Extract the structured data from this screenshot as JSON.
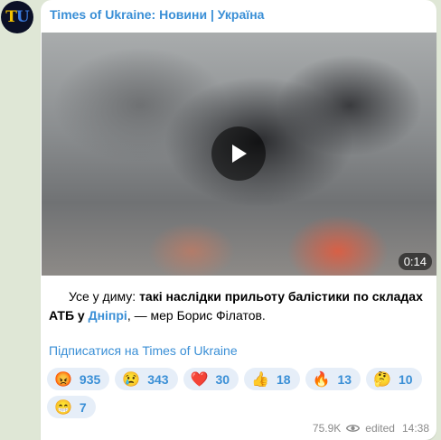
{
  "channel": {
    "avatar_letter_1": "T",
    "avatar_letter_2": "U",
    "name": "Times of Ukraine: Новини | Україна"
  },
  "video": {
    "duration": "0:14"
  },
  "post": {
    "text_part1": "Усе у диму: ",
    "text_bold": "такі наслідки прильоту балістики по складах АТБ у ",
    "text_link": "Дніпрі",
    "text_part2": ", — мер Борис Філатов.",
    "subscribe": "Підписатися на Times of Ukraine"
  },
  "reactions": [
    {
      "emoji": "😡",
      "count": "935"
    },
    {
      "emoji": "😢",
      "count": "343"
    },
    {
      "emoji": "❤️",
      "count": "30"
    },
    {
      "emoji": "👍",
      "count": "18"
    },
    {
      "emoji": "🔥",
      "count": "13"
    },
    {
      "emoji": "🤔",
      "count": "10"
    },
    {
      "emoji": "😁",
      "count": "7"
    }
  ],
  "footer": {
    "views": "75.9K",
    "edited": "edited",
    "time": "14:38"
  }
}
